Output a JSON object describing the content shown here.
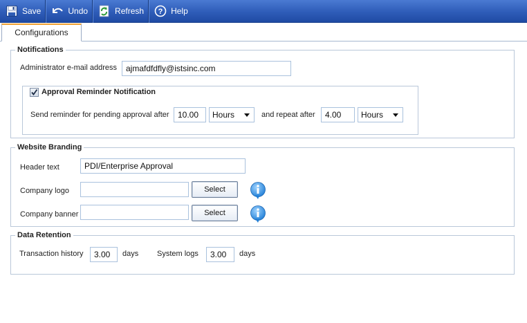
{
  "toolbar": {
    "save_label": "Save",
    "undo_label": "Undo",
    "refresh_label": "Refresh",
    "help_label": "Help"
  },
  "tabs": [
    {
      "label": "Configurations"
    }
  ],
  "notifications": {
    "legend": "Notifications",
    "admin_email_label": "Administrator e-mail address",
    "admin_email_value": "ajmafdfdfly@istsinc.com",
    "approval": {
      "legend": "Approval Reminder Notification",
      "checked": true,
      "send_label": "Send reminder for pending approval after",
      "send_value": "10.00",
      "send_unit": "Hours",
      "repeat_label": "and repeat after",
      "repeat_value": "4.00",
      "repeat_unit": "Hours"
    }
  },
  "branding": {
    "legend": "Website Branding",
    "header_text_label": "Header text",
    "header_text_value": "PDI/Enterprise Approval",
    "logo_label": "Company logo",
    "logo_value": "",
    "banner_label": "Company banner",
    "banner_value": "",
    "select_label": "Select"
  },
  "retention": {
    "legend": "Data Retention",
    "transaction_label": "Transaction history",
    "transaction_value": "3.00",
    "days_label": "days",
    "system_logs_label": "System logs",
    "system_logs_value": "3.00"
  },
  "icons": {
    "save": "save-icon",
    "undo": "undo-icon",
    "refresh": "refresh-icon",
    "help": "help-icon",
    "info": "info-icon",
    "check": "checkmark-icon"
  },
  "colors": {
    "toolbar": "#2e5cb8",
    "tab_accent": "#f0a030",
    "border": "#b9c7d9",
    "info_blue": "#2a8fe0"
  }
}
